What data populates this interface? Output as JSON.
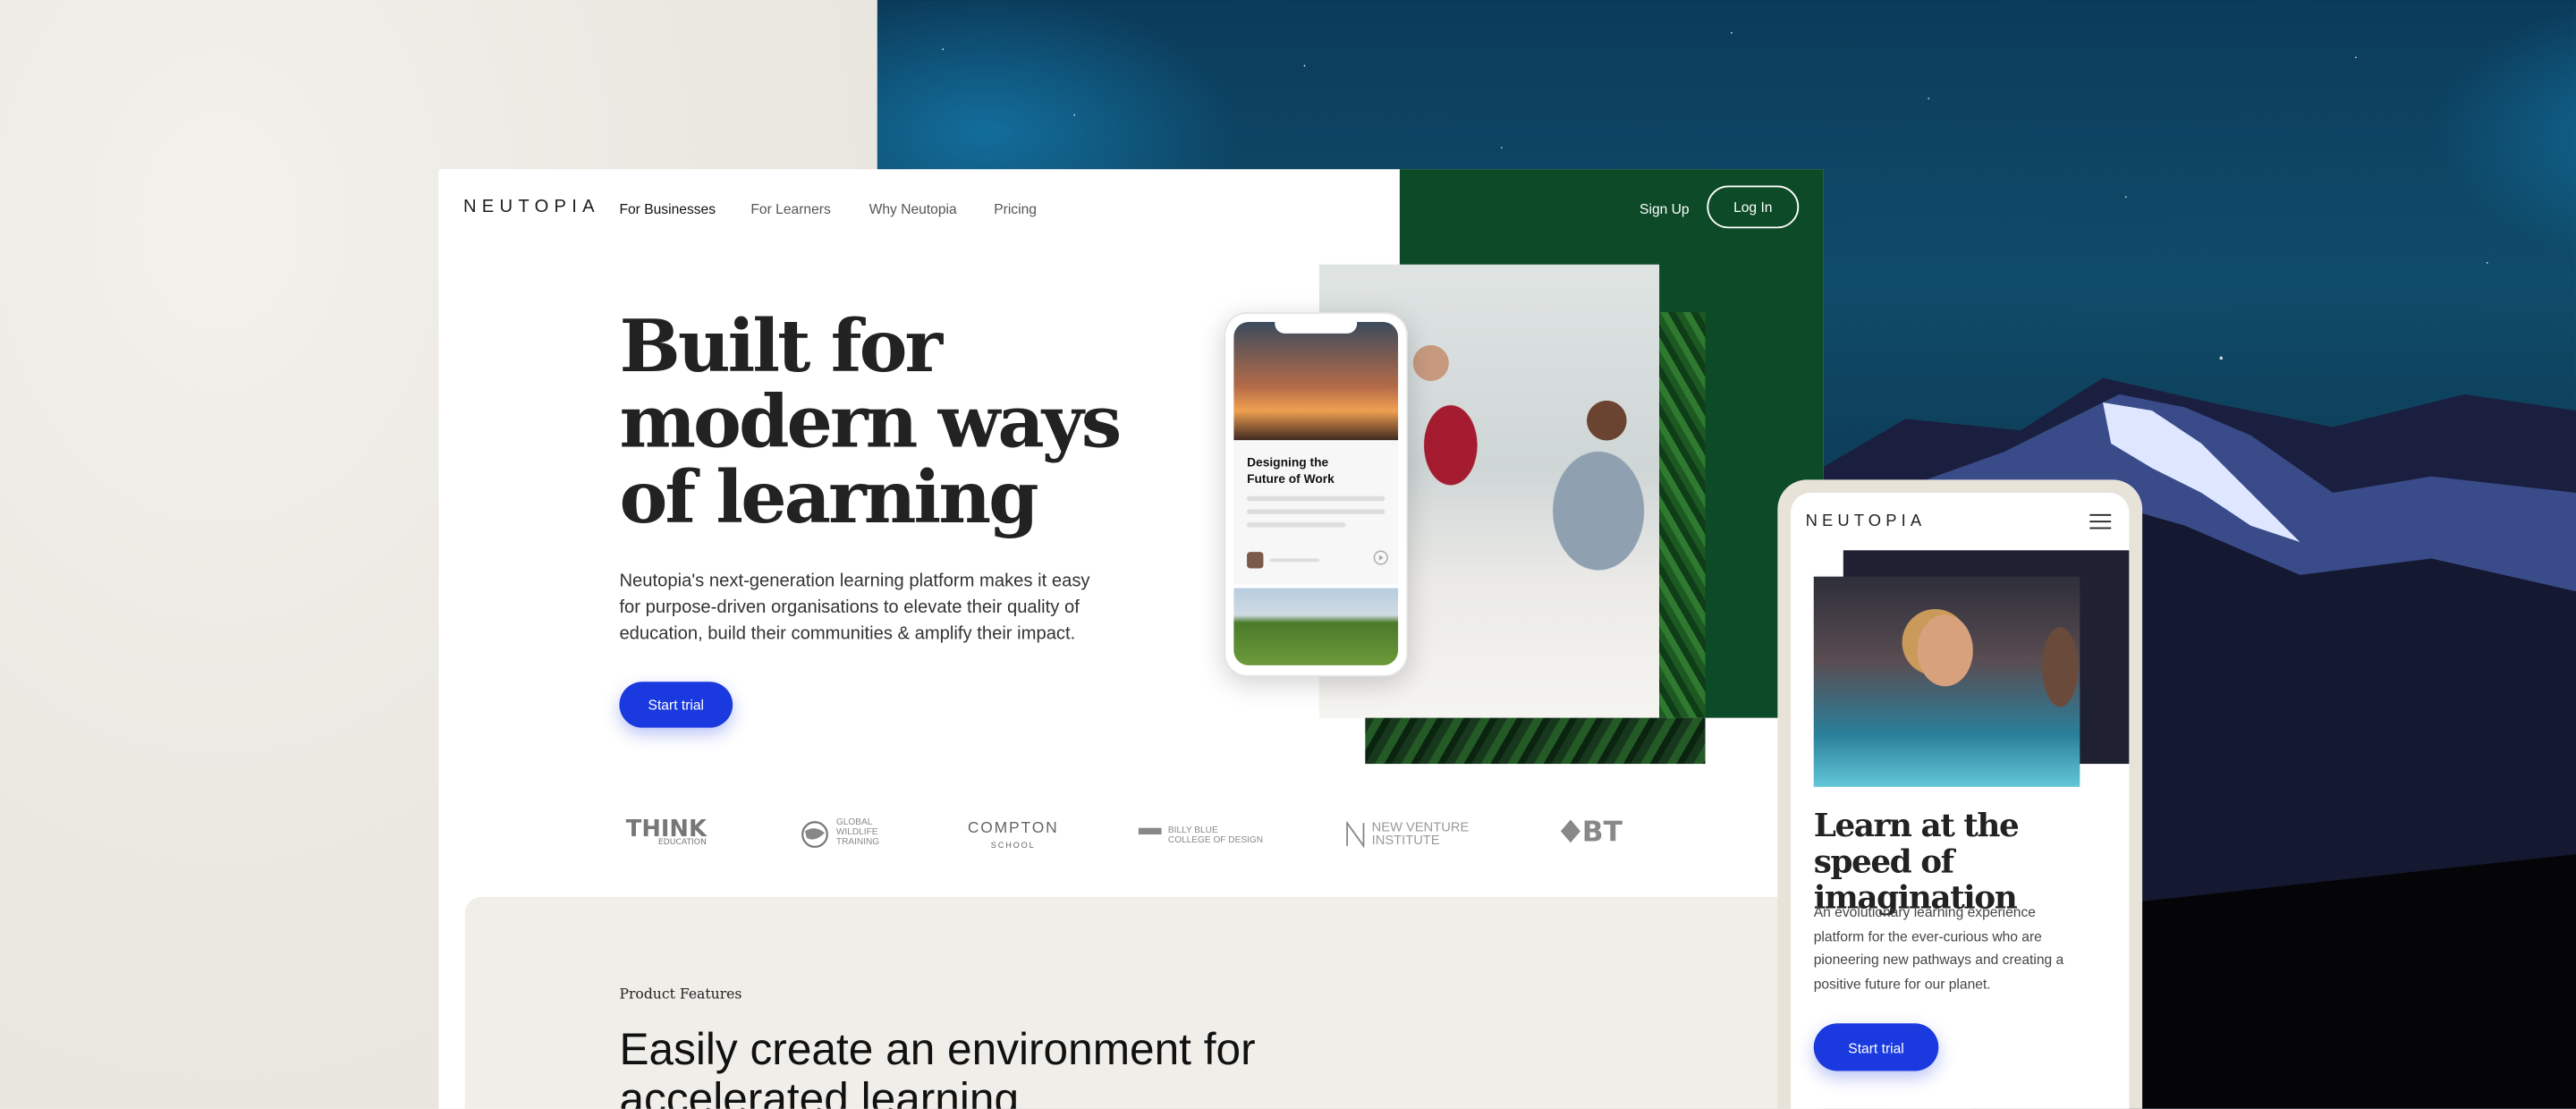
{
  "brand": {
    "logo": "NEUTOPIA"
  },
  "nav": {
    "items": [
      "For Businesses",
      "For Learners",
      "Why Neutopia",
      "Pricing"
    ],
    "signup_label": "Sign Up",
    "login_label": "Log In"
  },
  "hero": {
    "title_lines": [
      "Built for",
      "modern ways",
      "of learning"
    ],
    "description": "Neutopia's next-generation learning platform makes it easy for purpose-driven organisations to elevate their quality of education, build their communities & amplify their impact.",
    "cta_label": "Start trial"
  },
  "phone_card": {
    "title_lines": [
      "Designing the",
      "Future of Work"
    ]
  },
  "partner_logos": {
    "think": "THINK",
    "think_sub": "EDUCATION",
    "gwt_lines": [
      "GLOBAL",
      "WILDLIFE",
      "TRAINING"
    ],
    "compton": "COMPTON",
    "compton_sub": "SCHOOL",
    "billy_lines": [
      "BILLY BLUE",
      "COLLEGE OF DESIGN"
    ],
    "nvi_lines": [
      "NEW VENTURE",
      "INSTITUTE"
    ],
    "bt": "BT"
  },
  "features": {
    "eyebrow": "Product Features",
    "title": "Easily create an environment for accelerated learning"
  },
  "mobile": {
    "logo": "NEUTOPIA",
    "headline": "Learn at the speed of imagination",
    "paragraph": "An evolutionary learning experience platform for the ever-curious who are pioneering new pathways and creating a positive future for our planet.",
    "cta_label": "Start trial"
  },
  "colors": {
    "accent": "#1a3adf",
    "green_panel": "#0d4a27",
    "features_bg": "#f0eee8"
  },
  "icons": [
    "menu-icon",
    "play-icon"
  ]
}
